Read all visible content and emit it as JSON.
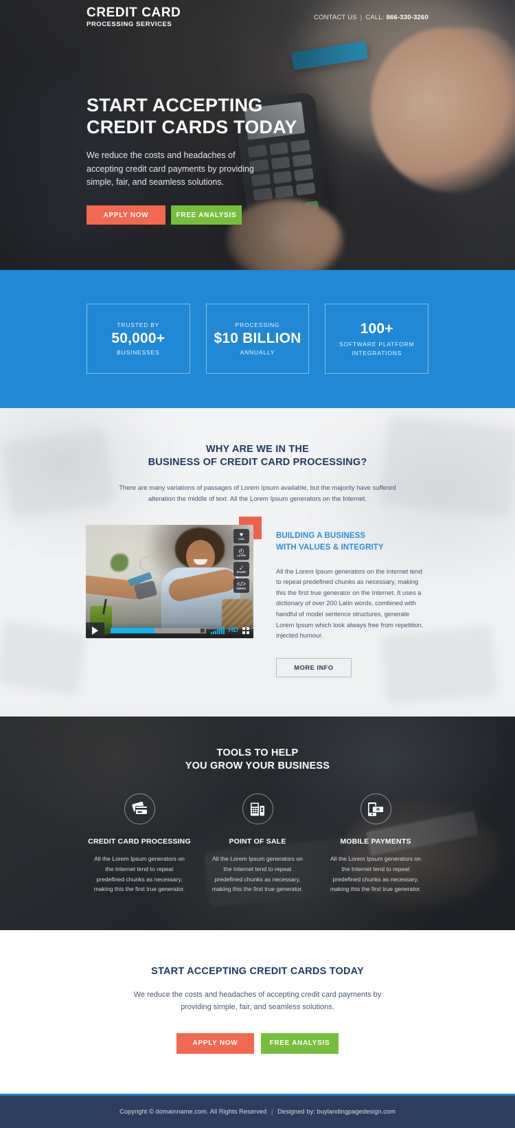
{
  "header": {
    "logo_main": "CREDIT CARD",
    "logo_sub": "PROCESSING SERVICES",
    "contact_label": "CONTACT US",
    "call_label": "CALL:",
    "phone": "866-330-3260",
    "separator": "|"
  },
  "hero": {
    "title_line1": "START ACCEPTING",
    "title_line2": "CREDIT CARDS TODAY",
    "subtitle": "We reduce the costs and headaches of accepting credit card payments by providing simple, fair, and seamless solutions.",
    "btn_apply": "APPLY NOW",
    "btn_free": "FREE ANALYSIS"
  },
  "stats": {
    "background_color": "#2088d4",
    "items": [
      {
        "top": "TRUSTED BY",
        "big": "50,000+",
        "bottom": "BUSINESSES",
        "big_position": "middle"
      },
      {
        "top": "PROCESSING",
        "big": "$10 BILLION",
        "bottom": "ANNUALLY",
        "big_position": "middle"
      },
      {
        "top": "",
        "big": "100+",
        "bottom_line1": "SOFTWARE PLATFORM",
        "bottom_line2": "INTEGRATIONS",
        "big_position": "top"
      }
    ]
  },
  "why": {
    "title_line1": "WHY ARE WE IN THE",
    "title_line2": "BUSINESS OF CREDIT CARD PROCESSING?",
    "lead": "There are many variations of passages of Lorem Ipsum available, but the majority have suffered alteration the middle of text. All the Lorem Ipsum generators on the Internet.",
    "subtitle_line1": "BUILDING A BUSINESS",
    "subtitle_line2": "WITH VALUES & INTEGRITY",
    "body": "All the Lorem Ipsum generators on the Internet tend to repeat predefined chunks as necessary, making this the first true generator on the Internet. It uses a dictionary of over 200 Latin words, combined with handful of model sentence structures, generate Lorem Ipsum which look always free from repetition, injected humour.",
    "btn_more": "MORE INFO",
    "accent_color": "#f2604a",
    "heading_color": "#2a8fdc"
  },
  "video": {
    "side_buttons": [
      {
        "icon": "heart-icon",
        "glyph": "♥",
        "label": "LIKE"
      },
      {
        "icon": "clock-icon",
        "glyph": "◴",
        "label": "LATER"
      },
      {
        "icon": "share-icon",
        "glyph": "⤦",
        "label": "SHARE"
      },
      {
        "icon": "code-icon",
        "glyph": "</>",
        "label": "EMBED"
      }
    ],
    "play_label": "play",
    "progress_percent": 46,
    "quality_label": "HD",
    "accent_color": "#14b3f0"
  },
  "tools": {
    "title_line1": "TOOLS TO HELP",
    "title_line2": "YOU GROW YOUR BUSINESS",
    "items": [
      {
        "icon": "credit-card-icon",
        "name": "CREDIT CARD PROCESSING",
        "desc": "All the Lorem Ipsum generators on the Internet tend to repeat predefined chunks as necessary, making this the first true generator."
      },
      {
        "icon": "point-of-sale-icon",
        "name": "POINT OF SALE",
        "desc": "All the Lorem Ipsum generators on the Internet tend to repeat predefined chunks as necessary, making this the first true generator."
      },
      {
        "icon": "mobile-payment-icon",
        "name": "MOBILE PAYMENTS",
        "desc": "All the Lorem Ipsum generators on the Internet tend to repeat predefined chunks as necessary, making this the first true generator."
      }
    ]
  },
  "cta": {
    "title": "START ACCEPTING CREDIT CARDS TODAY",
    "text": "We reduce the costs and headaches of accepting credit card payments by providing simple, fair, and seamless solutions.",
    "btn_apply": "APPLY NOW",
    "btn_free": "FREE ANALYSIS",
    "apply_color": "#f2694f",
    "free_color": "#76bf3c"
  },
  "footer": {
    "copyright": "Copyright © domainname.com. All Rights Reserved",
    "separator": "|",
    "designed_by": "Designed by: buylandingpagedesign.com",
    "background_color": "#2c3e5c"
  }
}
